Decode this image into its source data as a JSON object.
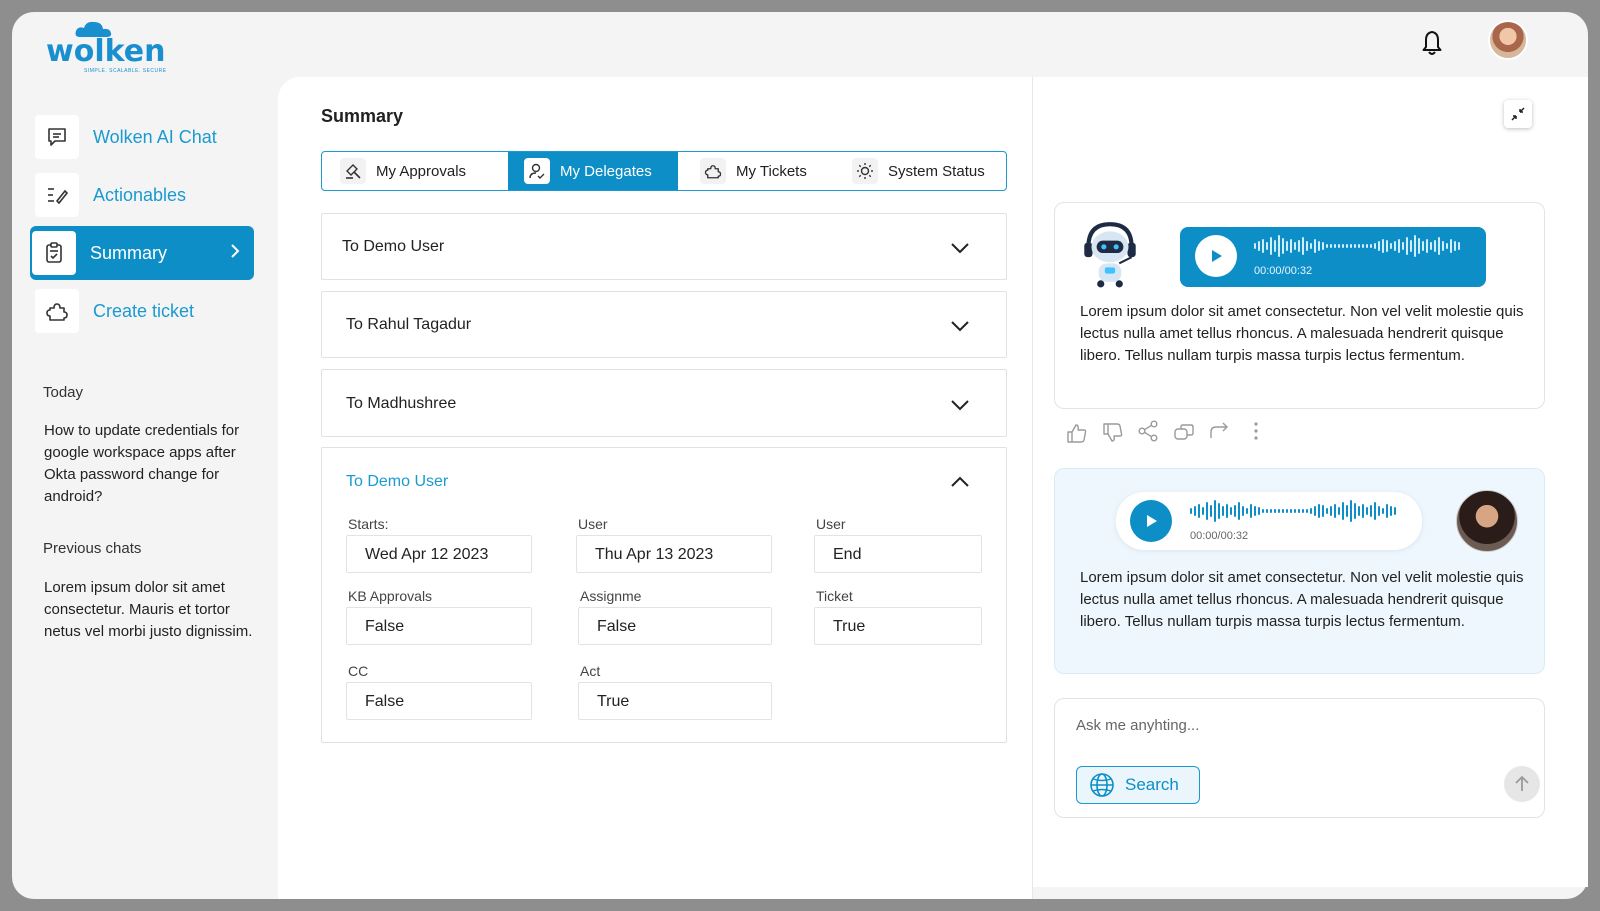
{
  "brand": {
    "name": "wolken",
    "tagline": "SIMPLE. SCALABLE. SECURE",
    "color": "#1a8fd0"
  },
  "header": {
    "bell_icon": "bell-icon",
    "avatar_icon": "user-avatar"
  },
  "sidebar": {
    "items": [
      {
        "label": "Wolken AI Chat",
        "icon": "chat-icon"
      },
      {
        "label": "Actionables",
        "icon": "actionables-icon"
      },
      {
        "label": "Summary",
        "icon": "clipboard-check-icon",
        "active": true
      },
      {
        "label": "Create ticket",
        "icon": "puzzle-icon"
      }
    ],
    "today_heading": "Today",
    "today_chat": "How to update credentials for google workspace apps after Okta password change for android?",
    "previous_heading": "Previous chats",
    "previous_chat": "Lorem ipsum dolor sit amet consectetur. Mauris et tortor netus vel morbi justo dignissim."
  },
  "main": {
    "title": "Summary",
    "tabs": [
      {
        "label": "My Approvals",
        "icon": "gavel-icon"
      },
      {
        "label": "My Delegates",
        "icon": "user-check-icon",
        "active": true
      },
      {
        "label": "My Tickets",
        "icon": "puzzle-icon"
      },
      {
        "label": "System Status",
        "icon": "sun-gear-icon"
      }
    ],
    "accordions": [
      {
        "title": "To Demo User",
        "open": false
      },
      {
        "title": "To Rahul Tagadur",
        "open": false
      },
      {
        "title": "To Madhushree",
        "open": false
      },
      {
        "title": "To Demo User",
        "open": true
      }
    ],
    "details": {
      "starts_label": "Starts:",
      "starts_value": "Wed Apr 12 2023",
      "user_label_1": "User",
      "user_value_1": "Thu Apr 13 2023",
      "user_label_2": "User",
      "user_value_2": "End",
      "kb_label": "KB Approvals",
      "kb_value": "False",
      "assign_label": "Assignme",
      "assign_value": "False",
      "ticket_label": "Ticket",
      "ticket_value": "True",
      "cc_label": "CC",
      "cc_value": "False",
      "act_label": "Act",
      "act_value": "True"
    }
  },
  "chat": {
    "bot_audio_time": "00:00/00:32",
    "bot_message": "Lorem ipsum dolor sit amet consectetur. Non vel velit molestie quis lectus nulla amet tellus rhoncus. A malesuada hendrerit quisque libero. Tellus nullam turpis massa turpis lectus fermentum.",
    "user_audio_time": "00:00/00:32",
    "user_message": "Lorem ipsum dolor sit amet consectetur. Non vel velit molestie quis lectus nulla amet tellus rhoncus. A malesuada hendrerit quisque libero. Tellus nullam turpis massa turpis lectus fermentum.",
    "reactions": [
      "thumbs-up-icon",
      "thumbs-down-icon",
      "share-icon",
      "copy-icon",
      "redo-icon",
      "more-vertical-icon"
    ],
    "input_placeholder": "Ask me anyhting...",
    "search_label": "Search"
  },
  "colors": {
    "accent": "#0d8ec7",
    "accent_light": "#eaf6fc"
  }
}
